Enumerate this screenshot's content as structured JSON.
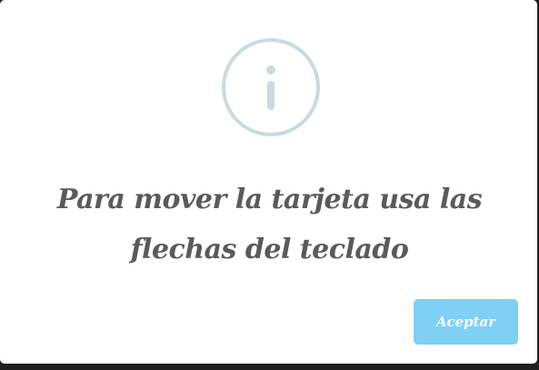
{
  "dialog": {
    "icon": "info-icon",
    "message": "Para mover la tarjeta usa las flechas del teclado",
    "accept_label": "Aceptar"
  },
  "colors": {
    "icon_stroke": "#c9dae1",
    "message_text": "#5a5a5a",
    "button_bg": "#7fd0f5",
    "button_text": "#ffffff"
  }
}
